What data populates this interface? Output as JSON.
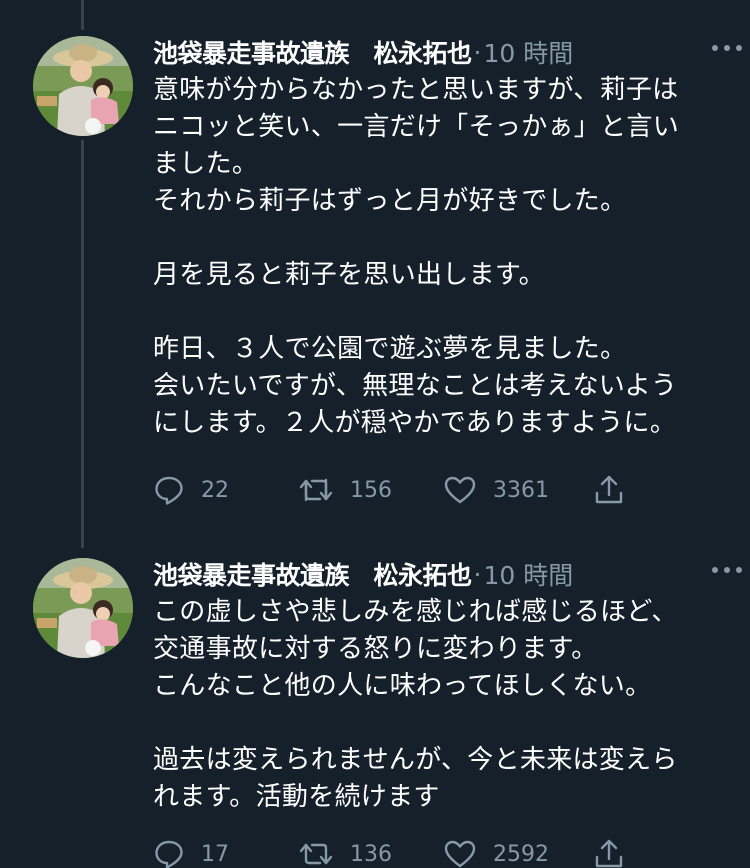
{
  "tweets": [
    {
      "author": "池袋暴走事故遺族　松永拓也",
      "separator": "·",
      "time": "10 時間",
      "lines": [
        "意味が分からなかったと思いますが、莉子は",
        "ニコッと笑い、一言だけ「そっかぁ」と言い",
        "ました。",
        "それから莉子はずっと月が好きでした。",
        "",
        "月を見ると莉子を思い出します。",
        "",
        "昨日、３人で公園で遊ぶ夢を見ました。",
        "会いたいですが、無理なことは考えないよう",
        "にします。２人が穏やかでありますように。"
      ],
      "replies": "22",
      "retweets": "156",
      "likes": "3361"
    },
    {
      "author": "池袋暴走事故遺族　松永拓也",
      "separator": "·",
      "time": "10 時間",
      "lines": [
        "この虚しさや悲しみを感じれば感じるほど、",
        "交通事故に対する怒りに変わります。",
        "こんなこと他の人に味わってほしくない。",
        "",
        "過去は変えられませんが、今と未来は変えら",
        "れます。活動を続けます"
      ],
      "replies": "17",
      "retweets": "136",
      "likes": "2592"
    }
  ],
  "colors": {
    "background": "#15202b",
    "text": "#ffffff",
    "secondary": "#8899a6",
    "thread_line": "#38444d"
  },
  "icons": [
    "more-icon",
    "reply-icon",
    "retweet-icon",
    "like-icon",
    "share-icon"
  ]
}
